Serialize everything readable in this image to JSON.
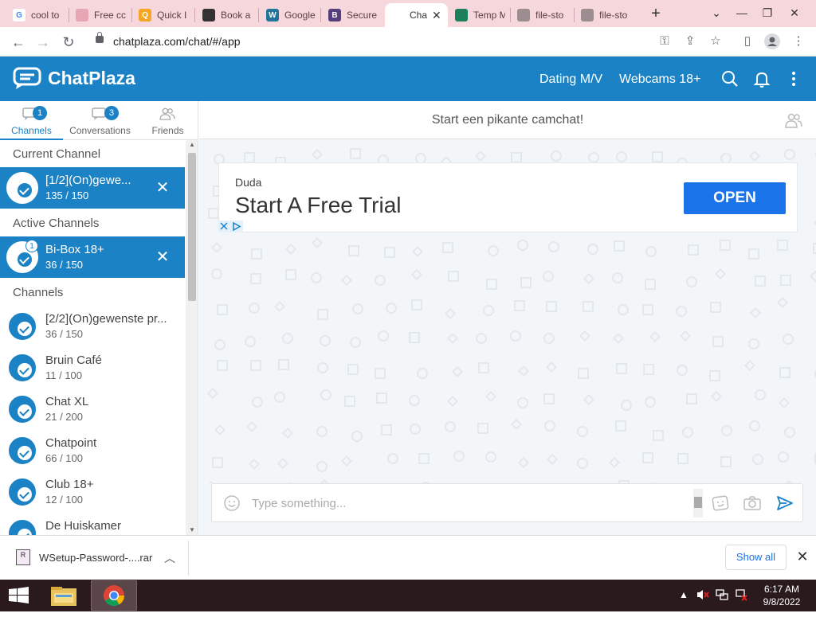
{
  "browser": {
    "tabs": [
      {
        "label": "cool to",
        "favicon_color": "#ffffff",
        "favicon_char": "G",
        "favicon_text_color": "#4285f4"
      },
      {
        "label": "Free cc",
        "favicon_color": "#e6a6b3",
        "favicon_char": "",
        "favicon_text_color": "#fff"
      },
      {
        "label": "Quick I",
        "favicon_color": "#f5a623",
        "favicon_char": "Q",
        "favicon_text_color": "#fff"
      },
      {
        "label": "Book a",
        "favicon_color": "#333333",
        "favicon_char": "",
        "favicon_text_color": "#fff"
      },
      {
        "label": "Google",
        "favicon_color": "#21759b",
        "favicon_char": "W",
        "favicon_text_color": "#fff"
      },
      {
        "label": "Secure",
        "favicon_color": "#563d7c",
        "favicon_char": "B",
        "favicon_text_color": "#fff"
      },
      {
        "label": "Cha",
        "favicon_color": "#ffffff",
        "favicon_char": "",
        "favicon_text_color": "#333",
        "active": true
      },
      {
        "label": "Temp M",
        "favicon_color": "#1a7f5a",
        "favicon_char": "",
        "favicon_text_color": "#fff"
      },
      {
        "label": "file-sto",
        "favicon_color": "#9e8d90",
        "favicon_char": "",
        "favicon_text_color": "#fff"
      },
      {
        "label": "file-sto",
        "favicon_color": "#9e8d90",
        "favicon_char": "",
        "favicon_text_color": "#fff"
      }
    ],
    "new_tab_label": "+",
    "url": "chatplaza.com/chat/#/app"
  },
  "app": {
    "brand": "ChatPlaza",
    "nav": {
      "dating": "Dating M/V",
      "webcams": "Webcams 18+"
    },
    "colors": {
      "primary": "#1b82c5",
      "ad_button": "#1a73e8"
    }
  },
  "sidebar": {
    "tabs": [
      {
        "label": "Channels",
        "badge": "1",
        "active": true
      },
      {
        "label": "Conversations",
        "badge": "3",
        "active": false
      },
      {
        "label": "Friends",
        "badge": "",
        "active": false
      }
    ],
    "sections": {
      "current": "Current Channel",
      "active": "Active Channels",
      "channels": "Channels"
    },
    "current_channel": {
      "name": "[1/2](On)gewe...",
      "count": "135 / 150"
    },
    "active_channels": [
      {
        "name": "Bi-Box 18+",
        "count": "36 / 150",
        "unread": "1"
      }
    ],
    "channels": [
      {
        "name": "[2/2](On)gewenste pr...",
        "count": "36 / 150"
      },
      {
        "name": "Bruin Café",
        "count": "11 / 100"
      },
      {
        "name": "Chat XL",
        "count": "21 / 200"
      },
      {
        "name": "Chatpoint",
        "count": "66 / 100"
      },
      {
        "name": "Club 18+",
        "count": "12 / 100"
      },
      {
        "name": "De Huiskamer",
        "count": ""
      }
    ]
  },
  "chat": {
    "title": "Start een pikante camchat!",
    "ad": {
      "brand": "Duda",
      "headline": "Start A Free Trial",
      "button": "OPEN"
    },
    "composer": {
      "placeholder": "Type something..."
    }
  },
  "downloads": {
    "file": "WSetup-Password-....rar",
    "show_all": "Show all"
  },
  "taskbar": {
    "time": "6:17 AM",
    "date": "9/8/2022"
  }
}
